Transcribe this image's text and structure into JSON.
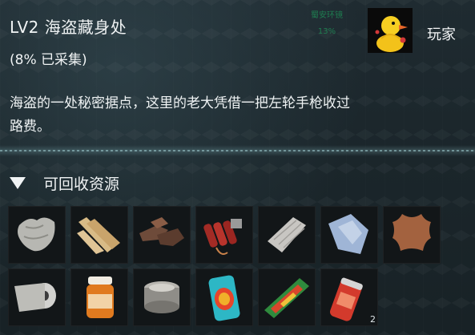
{
  "header": {
    "title": "LV2 海盗藏身处",
    "subtitle": " (8% 已采集)"
  },
  "safety": {
    "label": "蜀安环镜",
    "value": "13%",
    "color": "#1e8a55"
  },
  "player": {
    "label": "玩家",
    "avatar_icon": "duck-avatar-icon"
  },
  "description": {
    "line1": "海盗的一处秘密据点，这里的老大凭借一把左轮手枪收过",
    "line2": "路费。"
  },
  "section": {
    "label": "可回收资源",
    "toggle_icon": "triangle-down-icon"
  },
  "resources": [
    {
      "icon": "cloth-rag-icon",
      "count": ""
    },
    {
      "icon": "wood-planks-icon",
      "count": ""
    },
    {
      "icon": "scrap-pieces-icon",
      "count": ""
    },
    {
      "icon": "dynamite-bundle-icon",
      "count": ""
    },
    {
      "icon": "folded-fabric-icon",
      "count": ""
    },
    {
      "icon": "tarp-sheet-icon",
      "count": ""
    },
    {
      "icon": "leather-hide-icon",
      "count": ""
    },
    {
      "icon": "bandage-roll-icon",
      "count": ""
    },
    {
      "icon": "pill-bottle-icon",
      "count": ""
    },
    {
      "icon": "tin-can-icon",
      "count": ""
    },
    {
      "icon": "soda-can-icon",
      "count": ""
    },
    {
      "icon": "energy-bar-icon",
      "count": ""
    },
    {
      "icon": "red-can-icon",
      "count": "2"
    }
  ]
}
